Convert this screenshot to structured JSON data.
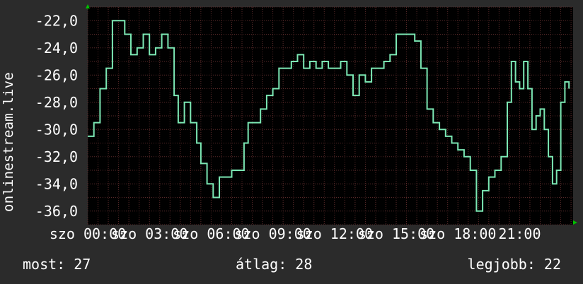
{
  "chart_data": {
    "type": "line",
    "ylabel": "onlinestream.live",
    "ylim": [
      -37,
      -21
    ],
    "yticks": [
      -22.0,
      -24.0,
      -26.0,
      -28.0,
      -30.0,
      -32.0,
      -34.0,
      -36.0
    ],
    "ytick_labels": [
      "-22,0",
      "-24,0",
      "-26,0",
      "-28,0",
      "-30,0",
      "-32,0",
      "-34,0",
      "-36,0"
    ],
    "xlim": [
      0,
      23.6
    ],
    "xticks": [
      0,
      3,
      6,
      9,
      12,
      15,
      18,
      21
    ],
    "xtick_labels": [
      "szo 00:00",
      "szo 03:00",
      "szo 06:00",
      "szo 09:00",
      "szo 12:00",
      "szo 15:00",
      "szo 18:00",
      "21:00"
    ],
    "grid": true,
    "colors": {
      "background": "#2b2b2b",
      "plot": "#000000",
      "line": "#7ce8b4",
      "grid": "#5a2a2a",
      "arrow": "#00c000"
    },
    "series": [
      {
        "x": [
          0.0,
          0.3,
          0.6,
          0.9,
          1.2,
          1.5,
          1.8,
          2.1,
          2.4,
          2.7,
          3.0,
          3.3,
          3.6,
          3.9,
          4.2,
          4.4,
          4.7,
          5.0,
          5.3,
          5.5,
          5.8,
          6.1,
          6.4,
          6.7,
          7.0,
          7.3,
          7.6,
          7.8,
          8.1,
          8.4,
          8.7,
          9.0,
          9.3,
          9.6,
          9.9,
          10.2,
          10.5,
          10.8,
          11.1,
          11.4,
          11.7,
          12.0,
          12.3,
          12.6,
          12.9,
          13.2,
          13.5,
          13.8,
          14.1,
          14.4,
          14.7,
          15.0,
          15.3,
          15.6,
          15.9,
          16.2,
          16.5,
          16.8,
          17.1,
          17.4,
          17.7,
          18.0,
          18.3,
          18.6,
          18.9,
          19.2,
          19.5,
          19.8,
          20.1,
          20.4,
          20.6,
          20.8,
          21.0,
          21.2,
          21.4,
          21.6,
          21.8,
          22.0,
          22.2,
          22.4,
          22.6,
          22.8,
          23.0,
          23.2,
          23.4
        ],
        "y": [
          -30.5,
          -29.5,
          -27.0,
          -25.5,
          -22.0,
          -22.0,
          -23.0,
          -24.5,
          -24.0,
          -23.0,
          -24.5,
          -24.0,
          -23.0,
          -24.0,
          -27.5,
          -29.5,
          -28.0,
          -29.5,
          -31.0,
          -32.5,
          -34.0,
          -35.0,
          -33.5,
          -33.5,
          -33.0,
          -33.0,
          -31.0,
          -29.5,
          -29.5,
          -28.5,
          -27.5,
          -27.0,
          -25.5,
          -25.5,
          -25.0,
          -24.5,
          -25.5,
          -25.0,
          -25.5,
          -25.0,
          -25.5,
          -25.5,
          -25.0,
          -26.0,
          -27.5,
          -26.0,
          -26.5,
          -25.5,
          -25.5,
          -25.0,
          -24.5,
          -23.0,
          -23.0,
          -23.0,
          -23.5,
          -25.5,
          -28.5,
          -29.5,
          -30.0,
          -30.5,
          -31.0,
          -31.5,
          -32.0,
          -33.0,
          -36.0,
          -34.5,
          -33.5,
          -33.0,
          -32.0,
          -28.0,
          -25.0,
          -26.5,
          -27.0,
          -25.0,
          -27.0,
          -30.0,
          -29.0,
          -28.5,
          -30.0,
          -32.0,
          -34.0,
          -33.0,
          -28.0,
          -26.5,
          -27.0
        ]
      }
    ]
  },
  "footer": {
    "current": "most: 27",
    "average": "átlag: 28",
    "best": "legjobb: 22"
  }
}
